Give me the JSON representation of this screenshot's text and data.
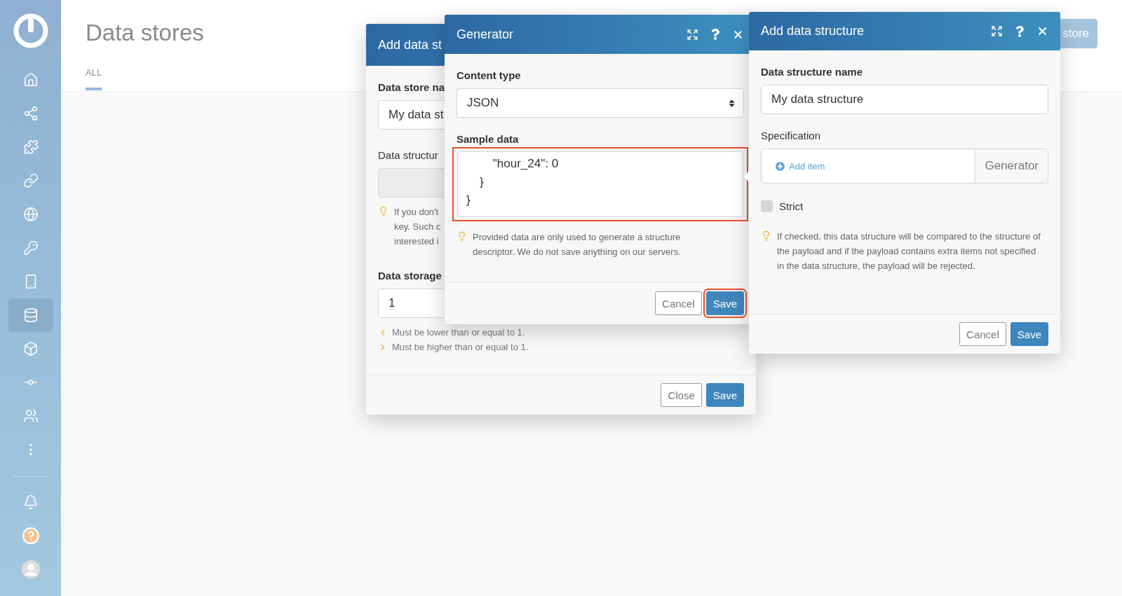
{
  "sidebar": {
    "items": [
      {
        "kind": "home",
        "selected": false
      },
      {
        "kind": "share",
        "selected": false
      },
      {
        "kind": "puzzle",
        "selected": false
      },
      {
        "kind": "link",
        "selected": false
      },
      {
        "kind": "globe",
        "selected": false
      },
      {
        "kind": "key",
        "selected": false
      },
      {
        "kind": "phone",
        "selected": false
      },
      {
        "kind": "database",
        "selected": true
      },
      {
        "kind": "cube",
        "selected": false
      },
      {
        "kind": "commit",
        "selected": false
      },
      {
        "kind": "users",
        "selected": false
      },
      {
        "kind": "more",
        "selected": false
      }
    ],
    "bottom_items": [
      {
        "kind": "bell"
      },
      {
        "kind": "help"
      },
      {
        "kind": "avatar"
      }
    ]
  },
  "header": {
    "title": "Data stores",
    "tabs": [
      {
        "label": "ALL",
        "selected": true
      }
    ],
    "button": "store"
  },
  "data_store_dialog": {
    "title": "Add data st",
    "name_label": "Data store na",
    "name_value": "My data st",
    "structure_label": "Data structur",
    "structure_field": {
      "disabled": true
    },
    "hint": [
      "If you don't",
      "key. Such c",
      "interested i"
    ],
    "storage_label": "Data storage",
    "storage_value": "1",
    "validation": [
      {
        "kind": "lower",
        "text": "Must be lower than or equal to 1."
      },
      {
        "kind": "higher",
        "text": "Must be higher than or equal to 1."
      }
    ],
    "buttons": [
      {
        "label": "Close",
        "primary": false
      },
      {
        "label": "Save",
        "primary": true
      }
    ]
  },
  "generator_dialog": {
    "title": "Generator",
    "content_type_label": "Content type",
    "content_type_value": "JSON",
    "sample_label": "Sample data",
    "sample_value": "        \"hour_24\": 0\n    }\n}",
    "sample_highlighted": true,
    "hint": "Provided data are only used to generate a structure descriptor. We do not save anything on our servers.",
    "buttons": [
      {
        "label": "Cancel",
        "primary": false,
        "highlighted": false
      },
      {
        "label": "Save",
        "primary": true,
        "highlighted": true
      }
    ]
  },
  "structure_dialog": {
    "title": "Add data structure",
    "name_label": "Data structure name",
    "name_value": "My data structure",
    "spec_label": "Specification",
    "add_item": "Add item",
    "generator_button": "Generator",
    "strict": {
      "label": "Strict",
      "checked": false
    },
    "hint": "If checked, this data structure will be compared to the structure of the payload and if the payload contains extra items not specified in the data structure, the payload will be rejected.",
    "buttons": [
      {
        "label": "Cancel",
        "primary": false
      },
      {
        "label": "Save",
        "primary": true
      }
    ]
  }
}
